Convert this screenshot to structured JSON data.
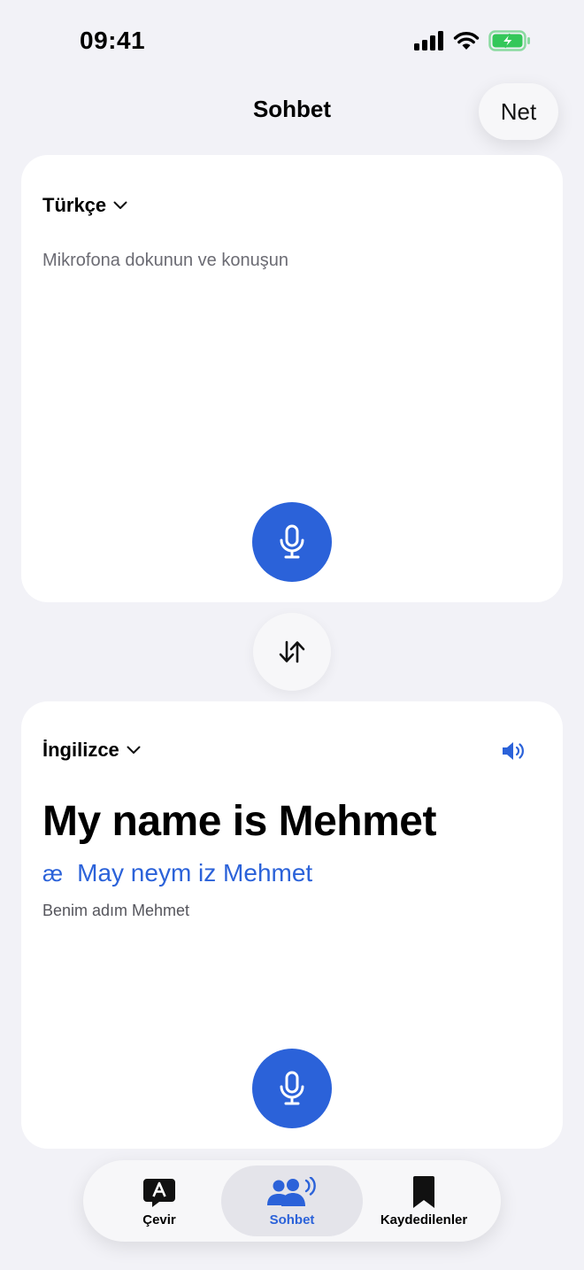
{
  "status_bar": {
    "time": "09:41",
    "icons": [
      "signal-icon",
      "wifi-icon",
      "battery-charging-icon"
    ]
  },
  "header": {
    "title": "Sohbet",
    "net_label": "Net"
  },
  "top_panel": {
    "language": "Türkçe",
    "placeholder": "Mikrofona dokunun ve konuşun"
  },
  "bottom_panel": {
    "language": "İngilizce",
    "translation": "My name is Mehmet",
    "pronunciation_symbol": "æ",
    "pronunciation": "May neym iz Mehmet",
    "source_text": "Benim adım Mehmet"
  },
  "tabs": [
    {
      "label": "Çevir",
      "icon": "translate-bubble-icon",
      "selected": false
    },
    {
      "label": "Sohbet",
      "icon": "conversation-icon",
      "selected": true
    },
    {
      "label": "Kaydedilenler",
      "icon": "bookmark-icon",
      "selected": false
    }
  ],
  "colors": {
    "accent": "#2b62d9",
    "background": "#f2f2f7",
    "battery_green": "#34c759"
  }
}
